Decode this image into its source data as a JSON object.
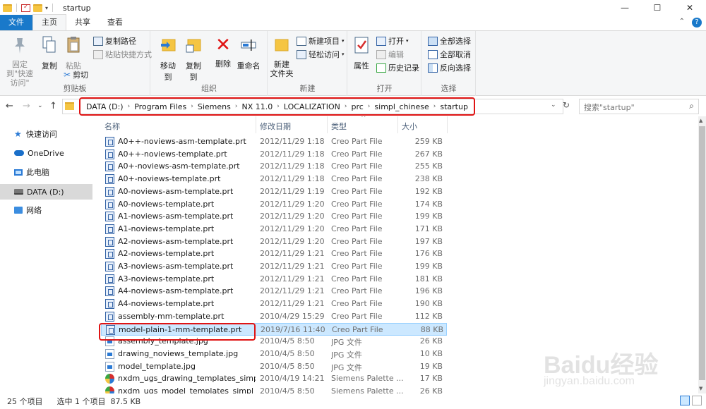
{
  "window": {
    "title": "startup",
    "controls": [
      "—",
      "☐",
      "✕"
    ]
  },
  "ribbon_tabs": [
    {
      "label": "文件",
      "active": false
    },
    {
      "label": "主页",
      "active": true
    },
    {
      "label": "共享",
      "active": false
    },
    {
      "label": "查看",
      "active": false
    }
  ],
  "ribbon": {
    "clipboard": {
      "label": "剪贴板",
      "pin": "固定到\"快速访问\"",
      "copy": "复制",
      "paste": "粘贴",
      "copy_path": "复制路径",
      "paste_shortcut": "粘贴快捷方式",
      "cut": "剪切"
    },
    "organize": {
      "label": "组织",
      "move_to": "移动到",
      "copy_to": "复制到",
      "delete": "删除",
      "rename": "重命名"
    },
    "new": {
      "label": "新建",
      "new_folder": "新建\n文件夹",
      "new_item": "新建项目",
      "easy_access": "轻松访问"
    },
    "open": {
      "label": "打开",
      "properties": "属性",
      "open": "打开",
      "edit": "编辑",
      "history": "历史记录"
    },
    "select": {
      "label": "选择",
      "select_all": "全部选择",
      "select_none": "全部取消",
      "invert": "反向选择"
    }
  },
  "address": {
    "crumbs": [
      "DATA (D:)",
      "Program Files",
      "Siemens",
      "NX 11.0",
      "LOCALIZATION",
      "prc",
      "simpl_chinese",
      "startup"
    ],
    "search_placeholder": "搜索\"startup\""
  },
  "nav_pane": [
    {
      "label": "快速访问",
      "icon": "star-icon"
    },
    {
      "label": "OneDrive",
      "icon": "cloud-icon"
    },
    {
      "label": "此电脑",
      "icon": "pc-icon"
    },
    {
      "label": "DATA (D:)",
      "icon": "drive-icon",
      "selected": true
    },
    {
      "label": "网络",
      "icon": "network-icon"
    }
  ],
  "columns": {
    "name": "名称",
    "date": "修改日期",
    "type": "类型",
    "size": "大小"
  },
  "files": [
    {
      "name": "A0++-noviews-asm-template.prt",
      "date": "2012/11/29 1:18",
      "type": "Creo Part File",
      "size": "259 KB",
      "icon": "prt"
    },
    {
      "name": "A0++-noviews-template.prt",
      "date": "2012/11/29 1:18",
      "type": "Creo Part File",
      "size": "267 KB",
      "icon": "prt"
    },
    {
      "name": "A0+-noviews-asm-template.prt",
      "date": "2012/11/29 1:18",
      "type": "Creo Part File",
      "size": "255 KB",
      "icon": "prt"
    },
    {
      "name": "A0+-noviews-template.prt",
      "date": "2012/11/29 1:18",
      "type": "Creo Part File",
      "size": "238 KB",
      "icon": "prt"
    },
    {
      "name": "A0-noviews-asm-template.prt",
      "date": "2012/11/29 1:19",
      "type": "Creo Part File",
      "size": "192 KB",
      "icon": "prt"
    },
    {
      "name": "A0-noviews-template.prt",
      "date": "2012/11/29 1:20",
      "type": "Creo Part File",
      "size": "174 KB",
      "icon": "prt"
    },
    {
      "name": "A1-noviews-asm-template.prt",
      "date": "2012/11/29 1:20",
      "type": "Creo Part File",
      "size": "199 KB",
      "icon": "prt"
    },
    {
      "name": "A1-noviews-template.prt",
      "date": "2012/11/29 1:20",
      "type": "Creo Part File",
      "size": "171 KB",
      "icon": "prt"
    },
    {
      "name": "A2-noviews-asm-template.prt",
      "date": "2012/11/29 1:20",
      "type": "Creo Part File",
      "size": "197 KB",
      "icon": "prt"
    },
    {
      "name": "A2-noviews-template.prt",
      "date": "2012/11/29 1:21",
      "type": "Creo Part File",
      "size": "176 KB",
      "icon": "prt"
    },
    {
      "name": "A3-noviews-asm-template.prt",
      "date": "2012/11/29 1:21",
      "type": "Creo Part File",
      "size": "199 KB",
      "icon": "prt"
    },
    {
      "name": "A3-noviews-template.prt",
      "date": "2012/11/29 1:21",
      "type": "Creo Part File",
      "size": "181 KB",
      "icon": "prt"
    },
    {
      "name": "A4-noviews-asm-template.prt",
      "date": "2012/11/29 1:21",
      "type": "Creo Part File",
      "size": "196 KB",
      "icon": "prt"
    },
    {
      "name": "A4-noviews-template.prt",
      "date": "2012/11/29 1:21",
      "type": "Creo Part File",
      "size": "190 KB",
      "icon": "prt"
    },
    {
      "name": "assembly-mm-template.prt",
      "date": "2010/4/29 15:29",
      "type": "Creo Part File",
      "size": "112 KB",
      "icon": "prt"
    },
    {
      "name": "model-plain-1-mm-template.prt",
      "date": "2019/7/16 11:40",
      "type": "Creo Part File",
      "size": "88 KB",
      "icon": "prt",
      "selected": true
    },
    {
      "name": "assembly_template.jpg",
      "date": "2010/4/5 8:50",
      "type": "JPG 文件",
      "size": "26 KB",
      "icon": "jpg"
    },
    {
      "name": "drawing_noviews_template.jpg",
      "date": "2010/4/5 8:50",
      "type": "JPG 文件",
      "size": "10 KB",
      "icon": "jpg"
    },
    {
      "name": "model_template.jpg",
      "date": "2010/4/5 8:50",
      "type": "JPG 文件",
      "size": "19 KB",
      "icon": "jpg"
    },
    {
      "name": "nxdm_ugs_drawing_templates_simpl_...",
      "date": "2010/4/19 14:21",
      "type": "Siemens Palette ...",
      "size": "17 KB",
      "icon": "pal"
    },
    {
      "name": "nxdm_ugs_model_templates_simpl_ch...",
      "date": "2010/4/5 8:50",
      "type": "Siemens Palette ...",
      "size": "26 KB",
      "icon": "pal"
    }
  ],
  "status": {
    "count": "25 个项目",
    "selection": "选中 1 个项目  87.5 KB"
  },
  "watermark": {
    "logo": "Baidu经验",
    "url": "jingyan.baidu.com"
  }
}
